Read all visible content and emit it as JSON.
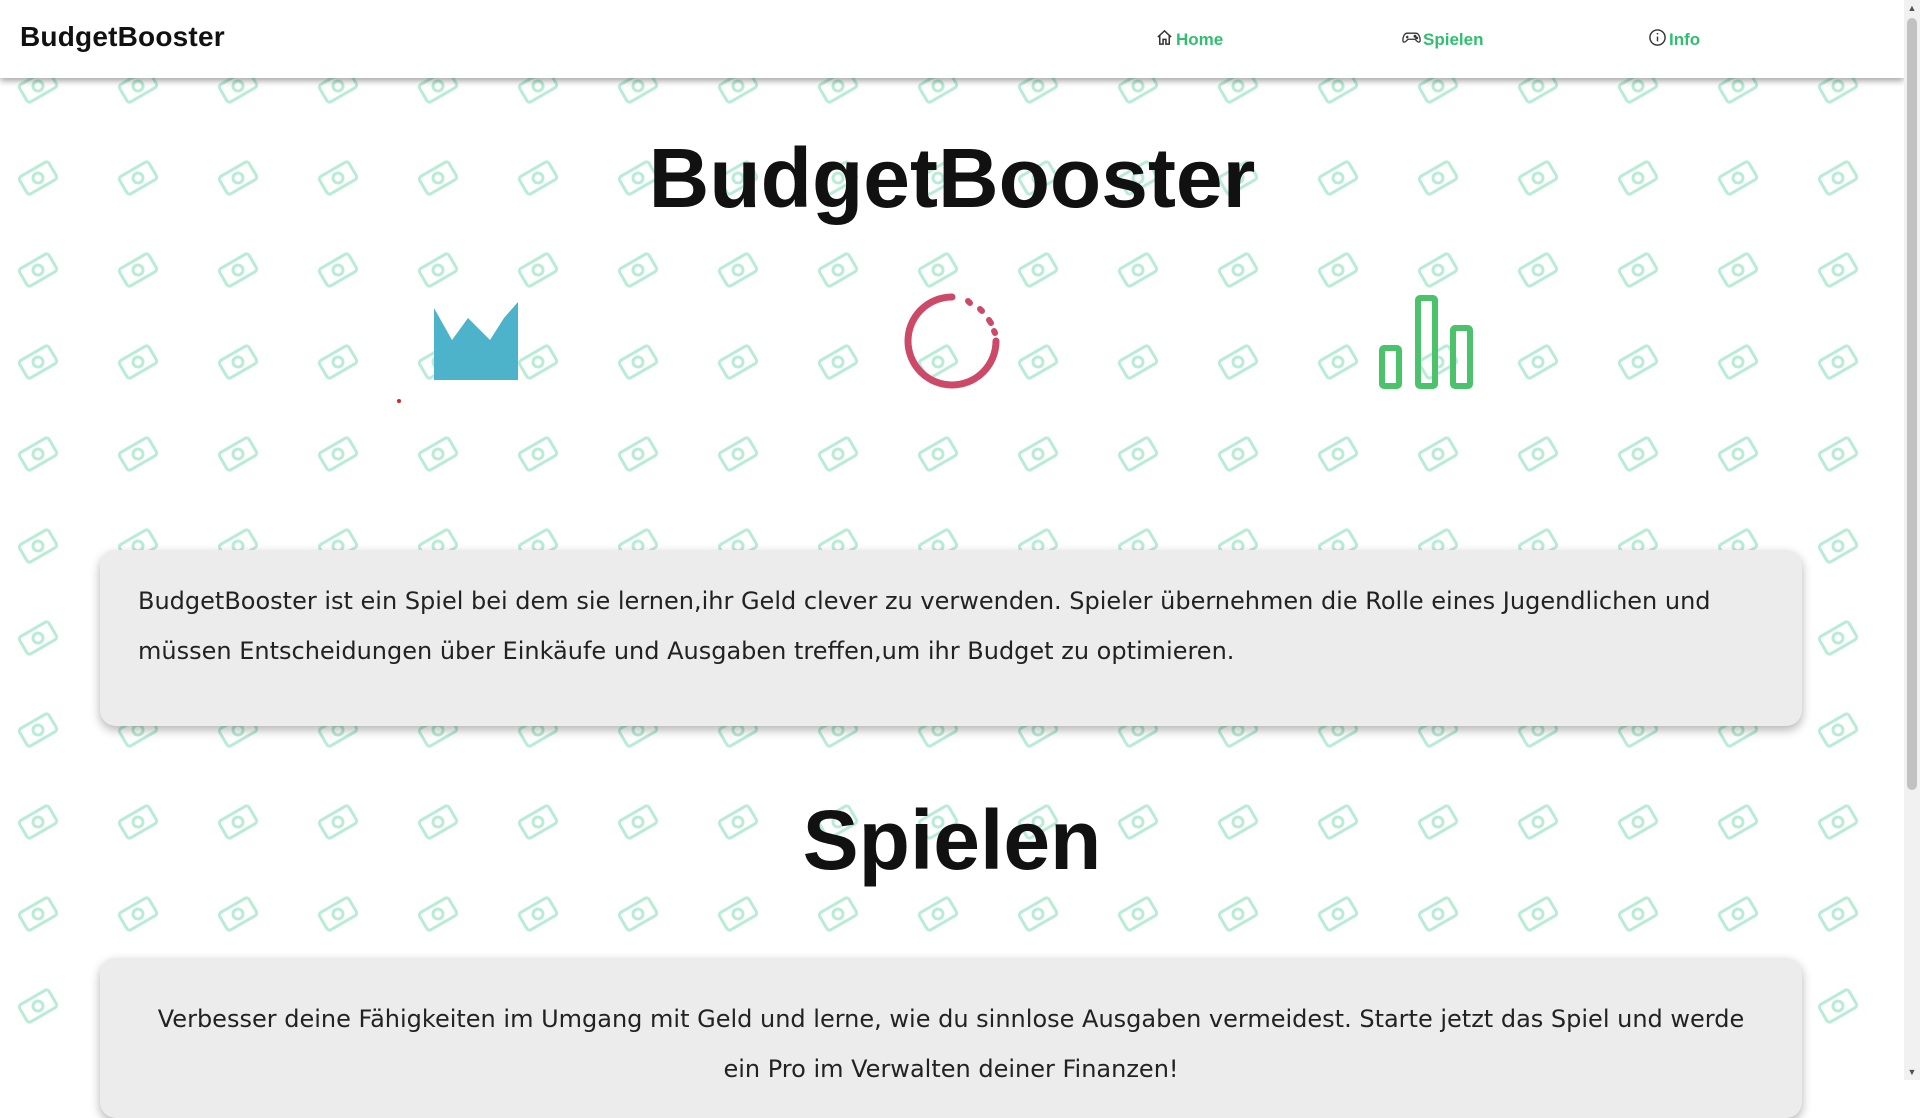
{
  "navbar": {
    "brand": "BudgetBooster",
    "links": [
      {
        "label": "Home",
        "icon": "home-icon"
      },
      {
        "label": "Spielen",
        "icon": "gamepad-icon"
      },
      {
        "label": "Info",
        "icon": "info-icon"
      }
    ]
  },
  "hero": {
    "title": "BudgetBooster",
    "icons": [
      {
        "name": "area-chart-icon",
        "color": "#4cb3cb"
      },
      {
        "name": "loading-spinner-icon",
        "color": "#cc4a68"
      },
      {
        "name": "bar-chart-icon",
        "color": "#4cc26c"
      }
    ],
    "description": "BudgetBooster ist ein Spiel bei dem sie lernen,ihr Geld clever zu verwenden. Spieler übernehmen die Rolle eines Jugendlichen und müssen Entscheidungen über Einkäufe und Ausgaben treffen,um ihr Budget zu optimieren."
  },
  "play_section": {
    "title": "Spielen",
    "description": "Verbesser deine Fähigkeiten im Umgang mit Geld und lerne, wie du sinnlose Ausgaben vermeidest. Starte jetzt das Spiel und werde ein Pro im Verwalten deiner Finanzen!"
  },
  "colors": {
    "accent": "#2fbf6e",
    "pattern": "#b9ecd6",
    "card_background": "#ececec"
  }
}
